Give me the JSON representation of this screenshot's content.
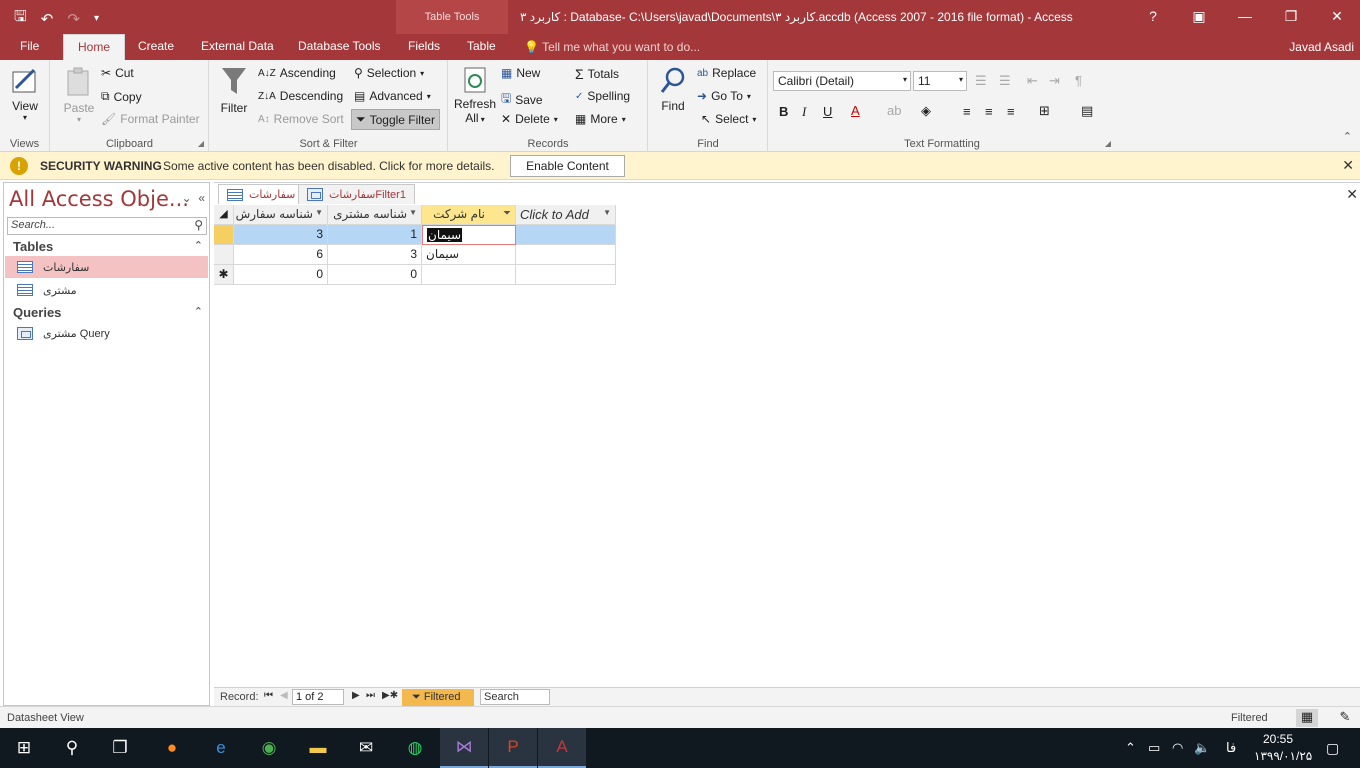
{
  "titlebar": {
    "context_tools": "Table Tools",
    "doc_title": "کاربرد ۳ : Database- C:\\Users\\javad\\Documents\\کاربرد ۳.accdb (Access 2007 - 2016 file format) - Access",
    "help": "?"
  },
  "tabs": {
    "file": "File",
    "home": "Home",
    "create": "Create",
    "external": "External Data",
    "dbtools": "Database Tools",
    "fields": "Fields",
    "table": "Table",
    "tellme": "Tell me what you want to do...",
    "user": "Javad Asadi"
  },
  "ribbon": {
    "views": {
      "view": "View",
      "label": "Views"
    },
    "clipboard": {
      "paste": "Paste",
      "cut": "Cut",
      "copy": "Copy",
      "painter": "Format Painter",
      "label": "Clipboard"
    },
    "sortfilter": {
      "filter": "Filter",
      "ascending": "Ascending",
      "descending": "Descending",
      "remove": "Remove Sort",
      "selection": "Selection",
      "advanced": "Advanced",
      "toggle": "Toggle Filter",
      "label": "Sort & Filter"
    },
    "records": {
      "refresh": "Refresh",
      "refresh2": "All",
      "new": "New",
      "save": "Save",
      "delete": "Delete",
      "totals": "Totals",
      "spelling": "Spelling",
      "more": "More",
      "label": "Records"
    },
    "find": {
      "find": "Find",
      "replace": "Replace",
      "goto": "Go To",
      "select": "Select",
      "label": "Find"
    },
    "textfmt": {
      "font": "Calibri (Detail)",
      "size": "11",
      "label": "Text Formatting"
    }
  },
  "security": {
    "title": "SECURITY WARNING",
    "message": "Some active content has been disabled. Click for more details.",
    "button": "Enable Content"
  },
  "nav": {
    "header": "All Access Obje...",
    "search_placeholder": "Search...",
    "tables_label": "Tables",
    "tables": [
      "سفارشات",
      "مشتری"
    ],
    "queries_label": "Queries",
    "queries": [
      "مشتری Query"
    ]
  },
  "doc_tabs": [
    "سفارشات",
    "سفارشاتFilter1"
  ],
  "datasheet": {
    "columns": [
      "شناسه سفارش",
      "شناسه مشتری",
      "نام شرکت",
      "Click to Add"
    ],
    "rows": [
      [
        "3",
        "1",
        "سیمان",
        ""
      ],
      [
        "6",
        "3",
        "سیمان",
        ""
      ],
      [
        "0",
        "0",
        "",
        ""
      ]
    ]
  },
  "recnav": {
    "label": "Record:",
    "position": "1 of 2",
    "filtered": "Filtered",
    "search": "Search"
  },
  "status": {
    "left": "Datasheet View",
    "right": "Filtered"
  },
  "taskbar": {
    "time": "20:55",
    "date": "۱۳۹۹/۰۱/۲۵",
    "lang": "فا"
  },
  "colors": {
    "accent": "#a4373a",
    "warning_bg": "#fff4ce",
    "selected_row": "#b6d6f5",
    "filter_header": "#fde68d"
  }
}
